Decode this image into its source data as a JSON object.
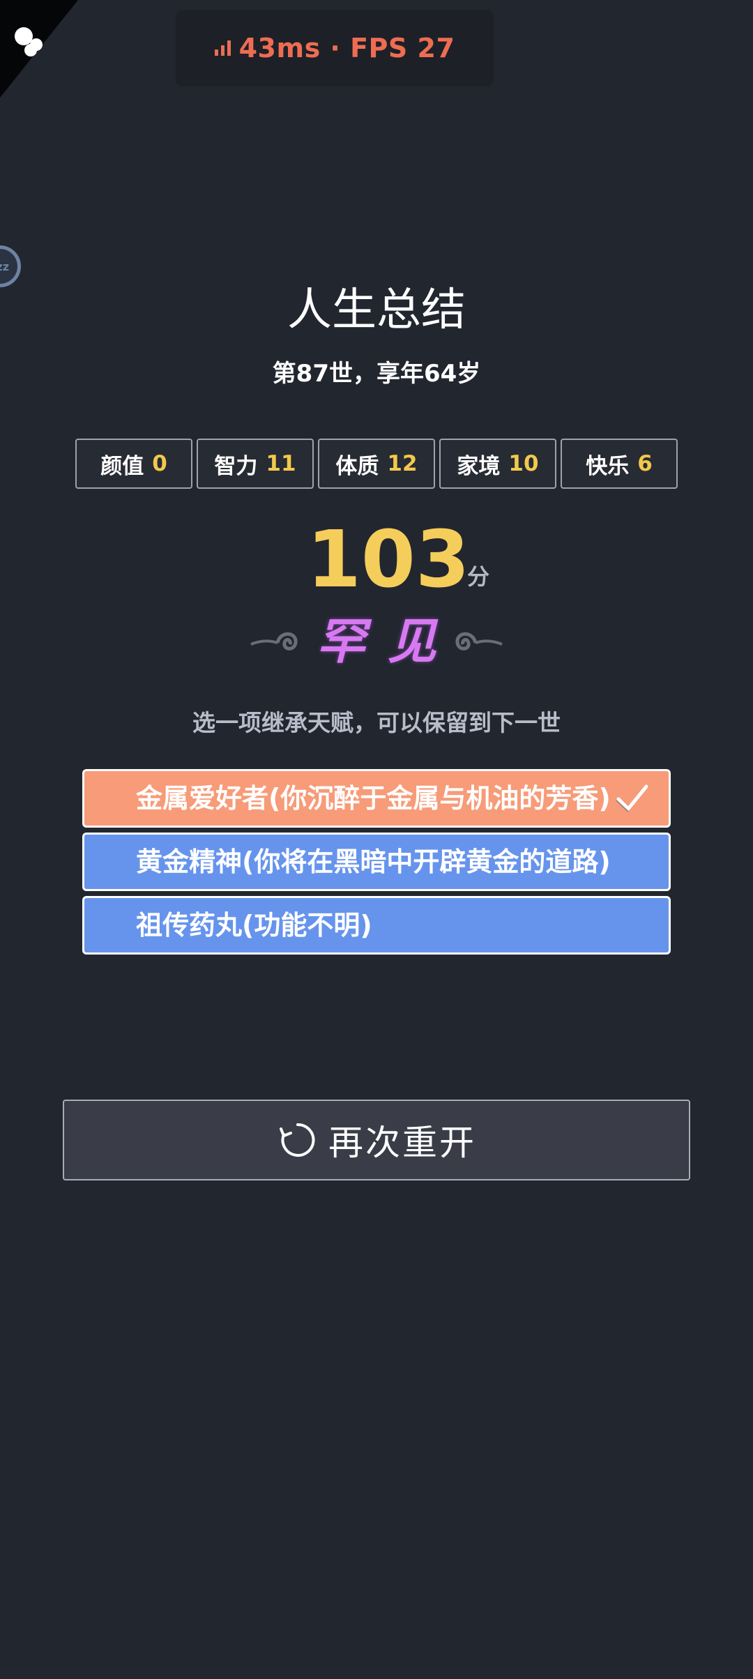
{
  "perf": {
    "text": "43ms · FPS 27",
    "color": "#ee6d52"
  },
  "summary": {
    "title": "人生总结",
    "subtitle": "第87世，享年64岁"
  },
  "stats": [
    {
      "label": "颜值",
      "value": "0"
    },
    {
      "label": "智力",
      "value": "11"
    },
    {
      "label": "体质",
      "value": "12"
    },
    {
      "label": "家境",
      "value": "10"
    },
    {
      "label": "快乐",
      "value": "6"
    }
  ],
  "score": {
    "value": "103",
    "unit": "分"
  },
  "grade": {
    "text": "罕见",
    "color": "#d879f2"
  },
  "inherit": {
    "hint": "选一项继承天赋，可以保留到下一世",
    "options": [
      {
        "label": "金属爱好者(你沉醉于金属与机油的芳香)",
        "selected": true
      },
      {
        "label": "黄金精神(你将在黑暗中开辟黄金的道路)",
        "selected": false
      },
      {
        "label": "祖传药丸(功能不明)",
        "selected": false
      }
    ]
  },
  "restart": {
    "label": "再次重开",
    "icon": "refresh-icon"
  },
  "colors": {
    "background": "#22262f",
    "selected_option": "#f79b78",
    "option": "#6694ec",
    "stat_value": "#f2c94c",
    "score": "#f5cd5b"
  }
}
